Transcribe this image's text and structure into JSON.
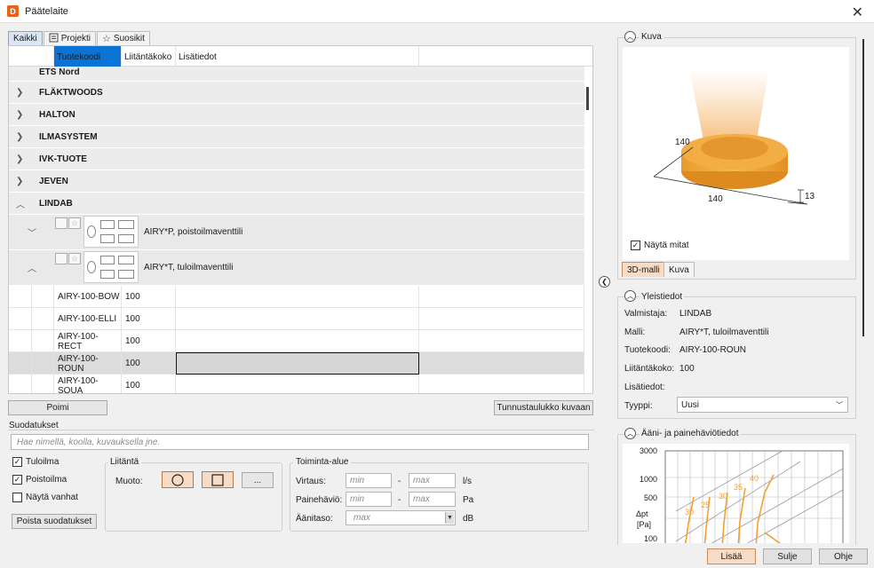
{
  "window": {
    "title": "Päätelaite",
    "app_icon": "D",
    "close_glyph": "✕"
  },
  "tabs": [
    {
      "label": "Kaikki",
      "icon": ""
    },
    {
      "label": "Projekti",
      "icon": "project-icon"
    },
    {
      "label": "Suosikit",
      "icon": "star-icon"
    }
  ],
  "grid": {
    "columns": [
      "Tuotekoodi",
      "Liitäntäkoko",
      "Lisätiedot"
    ],
    "groups": [
      "ETS Nord",
      "FLÄKTWOODS",
      "HALTON",
      "ILMASYSTEM",
      "IVK-TUOTE",
      "JEVEN",
      "LINDAB"
    ],
    "products": [
      {
        "name": "AIRY*P, poistoilmaventtili",
        "expanded": false
      },
      {
        "name": "AIRY*T, tuloilmaventtili",
        "expanded": true
      }
    ],
    "rows": [
      {
        "code": "AIRY-100-BOW",
        "size": "100"
      },
      {
        "code": "AIRY-100-ELLI",
        "size": "100"
      },
      {
        "code": "AIRY-100-RECT",
        "size": "100"
      },
      {
        "code": "AIRY-100-ROUN",
        "size": "100",
        "selected": true
      },
      {
        "code": "AIRY-100-SQUA",
        "size": "100"
      }
    ]
  },
  "buttons": {
    "poimi": "Poimi",
    "tunnustaulukko": "Tunnustaulukko kuvaan",
    "poista": "Poista suodatukset",
    "more": "..."
  },
  "filters": {
    "title": "Suodatukset",
    "search_placeholder": "Hae nimellä, koolla, kuvauksella jne.",
    "tuloilma": "Tuloilma",
    "poistoilma": "Poistoilma",
    "nayta_vanhat": "Näytä vanhat",
    "liitanta": "Liitäntä",
    "muoto": "Muoto:",
    "toiminta_alue": "Toiminta-alue",
    "virtaus": "Virtaus:",
    "painehavio": "Painehäviö:",
    "aanitaso": "Äänitaso:",
    "min": "min",
    "max": "max",
    "dash": "-",
    "unit_ls": "l/s",
    "unit_pa": "Pa",
    "unit_db": "dB"
  },
  "kuva": {
    "title": "Kuva",
    "dim_top": "140",
    "dim_bottom": "140",
    "dim_right": "13",
    "nayta_mitat": "Näytä mitat",
    "tab_3d": "3D-malli",
    "tab_kuva": "Kuva"
  },
  "yleistiedot": {
    "title": "Yleistiedot",
    "valmistaja_k": "Valmistaja:",
    "valmistaja_v": "LINDAB",
    "malli_k": "Malli:",
    "malli_v": "AIRY*T, tuloilmaventtili",
    "tuotekoodi_k": "Tuotekoodi:",
    "tuotekoodi_v": "AIRY-100-ROUN",
    "liitantakoko_k": "Liitäntäkoko:",
    "liitantakoko_v": "100",
    "lisatiedot_k": "Lisätiedot:",
    "tyyppi_k": "Tyyppi:",
    "tyyppi_v": "Uusi"
  },
  "aani": {
    "title": "Ääni- ja painehäviötiedot",
    "y_ticks": [
      "3000",
      "1000",
      "500",
      "100"
    ],
    "ylabel": "Δpt",
    "yunit": "[Pa]",
    "curve_labels": [
      "30",
      "25",
      "30",
      "35",
      "40"
    ]
  },
  "footer": {
    "lisaa": "Lisää",
    "sulje": "Sulje",
    "ohje": "Ohje"
  },
  "colors": {
    "accent": "#0a74d6",
    "orange": "#f2a030"
  }
}
